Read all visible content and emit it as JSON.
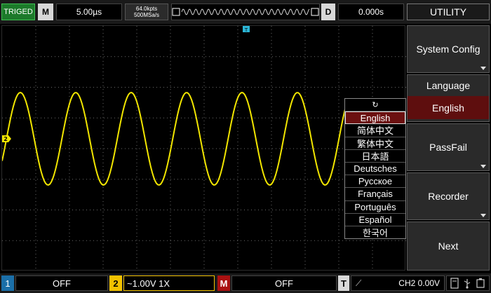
{
  "topbar": {
    "trigger_status": "TRIGED",
    "m_label": "M",
    "timebase": "5.00µs",
    "memory_depth": "64.0kpts",
    "sample_rate": "500MSa/s",
    "d_label": "D",
    "delay": "0.000s",
    "menu_title": "UTILITY"
  },
  "softkeys": {
    "system_config": "System Config",
    "language_title": "Language",
    "language_value": "English",
    "passfail": "PassFail",
    "recorder": "Recorder",
    "next": "Next"
  },
  "language_list": {
    "refresh_icon": "↻",
    "items": [
      "English",
      "简体中文",
      "繁体中文",
      "日本語",
      "Deutsches",
      "Русское",
      "Français",
      "Português",
      "Español",
      "한국어"
    ],
    "selected": "English"
  },
  "screen": {
    "trigger_marker": "T",
    "ch2_marker": "2"
  },
  "bottombar": {
    "ch1_label": "1",
    "ch1_state": "OFF",
    "ch2_label": "2",
    "ch2_state": "~1.00V  1X",
    "math_label": "M",
    "math_state": "OFF",
    "t_label": "T",
    "trigger_slope": "⟋",
    "trigger_source": "CH2 0.00V"
  },
  "colors": {
    "ch1": "#1b6fa8",
    "ch2": "#f2c200",
    "math": "#aa1111",
    "selected": "#6b1010",
    "trig_green": "#1c7a2a"
  },
  "icons": [
    "refresh-icon",
    "usb-icon",
    "file-icon",
    "trigger-slope-icon"
  ]
}
